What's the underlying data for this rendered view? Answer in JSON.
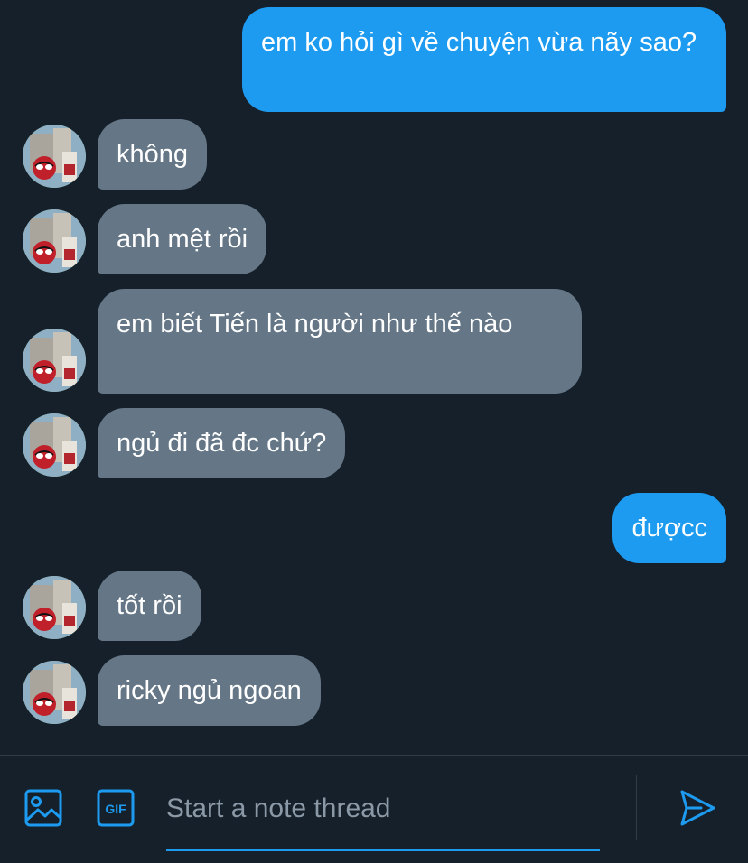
{
  "messages": [
    {
      "dir": "out",
      "text": "em ko hỏi gì về chuyện vừa nãy sao?"
    },
    {
      "dir": "in",
      "text": "không"
    },
    {
      "dir": "in",
      "text": "anh mệt rồi"
    },
    {
      "dir": "in",
      "text": "em biết Tiến là người như thế nào"
    },
    {
      "dir": "in",
      "text": "ngủ đi đã đc chứ?"
    },
    {
      "dir": "out",
      "text": "đượcc"
    },
    {
      "dir": "in",
      "text": "tốt rồi"
    },
    {
      "dir": "in",
      "text": "ricky ngủ ngoan"
    }
  ],
  "composer": {
    "placeholder": "Start a note thread",
    "gif_label": "GIF",
    "icons": {
      "image": "image-icon",
      "gif": "gif-icon",
      "send": "send-icon"
    }
  },
  "colors": {
    "background": "#15202b",
    "outgoing_bubble": "#1d9bf0",
    "incoming_bubble": "#657786",
    "accent": "#1d9bf0"
  }
}
